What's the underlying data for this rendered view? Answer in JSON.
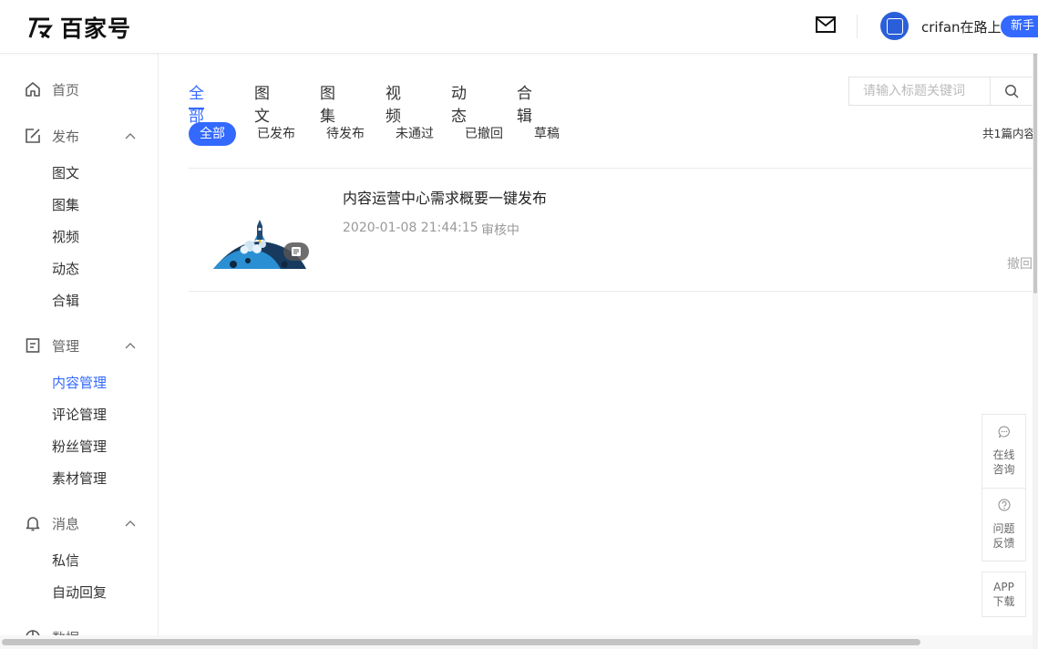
{
  "header": {
    "logo_text": "百家号",
    "username": "crifan在路上",
    "newbie_label": "新手",
    "icons": [
      "mail-icon",
      "avatar"
    ]
  },
  "sidebar": {
    "home": "首页",
    "publish": {
      "label": "发布",
      "items": [
        "图文",
        "图集",
        "视频",
        "动态",
        "合辑"
      ]
    },
    "manage": {
      "label": "管理",
      "items": [
        "内容管理",
        "评论管理",
        "粉丝管理",
        "素材管理"
      ],
      "active_item": "内容管理"
    },
    "message": {
      "label": "消息",
      "items": [
        "私信",
        "自动回复"
      ]
    },
    "data_label": "数据"
  },
  "main": {
    "tabs": [
      "全部",
      "图文",
      "图集",
      "视频",
      "动态",
      "合辑"
    ],
    "active_tab": "全部",
    "search_placeholder": "请输入标题关键词",
    "filters": [
      "全部",
      "已发布",
      "待发布",
      "未通过",
      "已撤回",
      "草稿"
    ],
    "active_filter": "全部",
    "total_count": "共1篇内容",
    "items": [
      {
        "title": "内容运营中心需求概要一键发布",
        "date": "2020-01-08 21:44:15",
        "status": "审核中",
        "action": "撤回"
      }
    ]
  },
  "float_panel": {
    "consult": "在线咨询",
    "consult_lines": [
      "在线",
      "咨询"
    ],
    "feedback": "问题反馈",
    "feedback_lines": [
      "问题",
      "反馈"
    ],
    "app_lines": [
      "APP",
      "下载"
    ]
  },
  "colors": {
    "accent": "#3369ff",
    "text": "#333333",
    "muted": "#999999",
    "border": "#ececec"
  }
}
